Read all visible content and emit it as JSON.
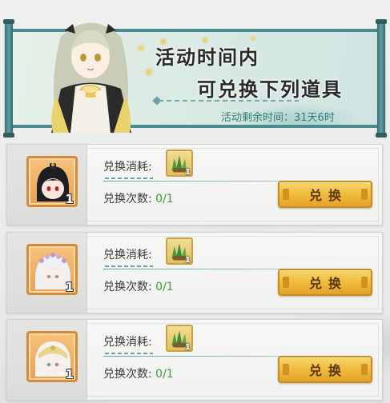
{
  "banner": {
    "headline_line1": "活动时间内",
    "headline_line2": "可兑换下列道具",
    "timer_text": "活动剩余时间：31天6时"
  },
  "shop_items": [
    {
      "item_icon": "character-head-black-hair",
      "item_count": "1",
      "cost_label": "兑换消耗:",
      "cost_icon": "green-herb-bundle-icon",
      "cost_qty": "1",
      "times_label": "兑换次数:",
      "times_value": "0/1",
      "button_label": "兑换"
    },
    {
      "item_icon": "character-head-white-hair-flower-crown",
      "item_count": "1",
      "cost_label": "兑换消耗:",
      "cost_icon": "green-herb-bundle-icon",
      "cost_qty": "1",
      "times_label": "兑换次数:",
      "times_value": "0/1",
      "button_label": "兑换"
    },
    {
      "item_icon": "character-head-white-hair-hood",
      "item_count": "1",
      "cost_label": "兑换消耗:",
      "cost_icon": "green-herb-bundle-icon",
      "cost_qty": "1",
      "times_label": "兑换次数:",
      "times_value": "0/1",
      "button_label": "兑换"
    }
  ],
  "colors": {
    "accent_teal": "#4b8a8e",
    "button_gold": "#efb93a",
    "times_green": "#3f9b3a",
    "timer_teal": "#2d7f79"
  }
}
